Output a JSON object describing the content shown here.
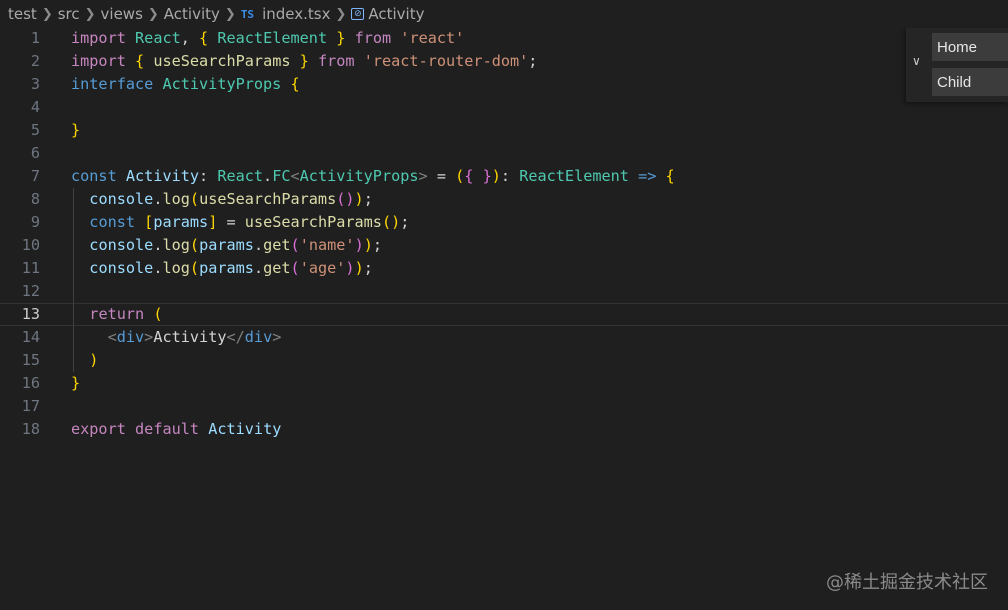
{
  "breadcrumb": {
    "items": [
      "test",
      "src",
      "views",
      "Activity",
      "index.tsx",
      "Activity"
    ],
    "file_badge": "TS",
    "symbol_icon": "[⊘]"
  },
  "editor": {
    "current_line": 13,
    "line_numbers": [
      "1",
      "2",
      "3",
      "4",
      "5",
      "6",
      "7",
      "8",
      "9",
      "10",
      "11",
      "12",
      "13",
      "14",
      "15",
      "16",
      "17",
      "18"
    ],
    "lines": [
      "import React, { ReactElement } from 'react'",
      "import { useSearchParams } from 'react-router-dom';",
      "interface ActivityProps {",
      "",
      "}",
      "",
      "const Activity: React.FC<ActivityProps> = ({ }): ReactElement => {",
      "  console.log(useSearchParams());",
      "  const [params] = useSearchParams();",
      "  console.log(params.get('name'));",
      "  console.log(params.get('age'));",
      "",
      "  return (",
      "    <div>Activity</div>",
      "  )",
      "}",
      "",
      "export default Activity"
    ]
  },
  "route_panel": {
    "items": [
      "Home",
      "Child"
    ],
    "chevron": "chevron-down-icon"
  },
  "watermark": "@稀土掘金技术社区",
  "colors": {
    "background": "#1f1f1f",
    "keyword": "#569cd6",
    "control": "#c586c0",
    "type": "#4ec9b0",
    "function": "#dcdcaa",
    "string": "#ce9178",
    "variable": "#9cdcfe"
  }
}
